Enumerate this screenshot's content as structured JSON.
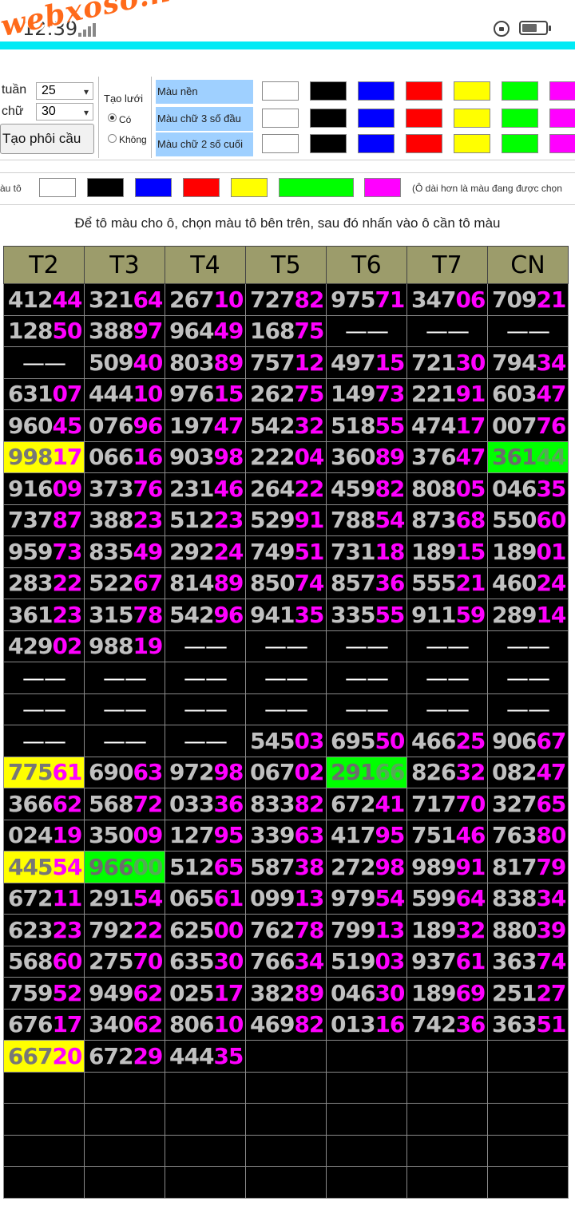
{
  "status_bar": {
    "time": "12:39"
  },
  "watermark": "webxoso.net",
  "controls": {
    "weeks_label": "tuần",
    "weeks_value": "25",
    "digits_label": "chữ",
    "digits_value": "30",
    "create_button": "Tạo phôi cầu",
    "grid_label": "Tạo lưới",
    "grid_yes": "Có",
    "grid_no": "Không"
  },
  "color_rows": [
    {
      "label": "Màu nền"
    },
    {
      "label": "Màu chữ 3 số đầu"
    },
    {
      "label": "Màu chữ 2 số cuối"
    }
  ],
  "palette": [
    "#ffffff",
    "#000000",
    "#0000ff",
    "#ff0000",
    "#ffff00",
    "#00ff00",
    "#ff00ff"
  ],
  "tool": {
    "label": "àu tô",
    "note": "(Ô dài hơn là màu đang được chọn"
  },
  "instruction": "Để tô màu cho ô, chọn màu tô bên trên, sau đó nhấn vào ô cần tô màu",
  "table": {
    "headers": [
      "T2",
      "T3",
      "T4",
      "T5",
      "T6",
      "T7",
      "CN"
    ],
    "rows": [
      [
        {
          "v": "41244"
        },
        {
          "v": "32164"
        },
        {
          "v": "26710"
        },
        {
          "v": "72782"
        },
        {
          "v": "97571"
        },
        {
          "v": "34706"
        },
        {
          "v": "70921"
        }
      ],
      [
        {
          "v": "12850"
        },
        {
          "v": "38897"
        },
        {
          "v": "96449"
        },
        {
          "v": "16875"
        },
        {
          "v": "—"
        },
        {
          "v": "—"
        },
        {
          "v": "—"
        }
      ],
      [
        {
          "v": "—"
        },
        {
          "v": "50940"
        },
        {
          "v": "80389"
        },
        {
          "v": "75712"
        },
        {
          "v": "49715"
        },
        {
          "v": "72130"
        },
        {
          "v": "79434"
        }
      ],
      [
        {
          "v": "63107"
        },
        {
          "v": "44410"
        },
        {
          "v": "97615"
        },
        {
          "v": "26275"
        },
        {
          "v": "14973"
        },
        {
          "v": "22191"
        },
        {
          "v": "60347"
        }
      ],
      [
        {
          "v": "96045"
        },
        {
          "v": "07696"
        },
        {
          "v": "19747"
        },
        {
          "v": "54232"
        },
        {
          "v": "51855"
        },
        {
          "v": "47417"
        },
        {
          "v": "00776"
        }
      ],
      [
        {
          "v": "99817",
          "bg": "yellow"
        },
        {
          "v": "06616"
        },
        {
          "v": "90398"
        },
        {
          "v": "22204"
        },
        {
          "v": "36089"
        },
        {
          "v": "37647"
        },
        {
          "v": "36144",
          "bg": "green"
        }
      ],
      [
        {
          "v": "91609"
        },
        {
          "v": "37376"
        },
        {
          "v": "23146"
        },
        {
          "v": "26422"
        },
        {
          "v": "45982"
        },
        {
          "v": "80805"
        },
        {
          "v": "04635"
        }
      ],
      [
        {
          "v": "73787"
        },
        {
          "v": "38823"
        },
        {
          "v": "51223"
        },
        {
          "v": "52991"
        },
        {
          "v": "78854"
        },
        {
          "v": "87368"
        },
        {
          "v": "55060"
        }
      ],
      [
        {
          "v": "95973"
        },
        {
          "v": "83549"
        },
        {
          "v": "29224"
        },
        {
          "v": "74951"
        },
        {
          "v": "73118"
        },
        {
          "v": "18915"
        },
        {
          "v": "18901"
        }
      ],
      [
        {
          "v": "28322"
        },
        {
          "v": "52267"
        },
        {
          "v": "81489"
        },
        {
          "v": "85074"
        },
        {
          "v": "85736"
        },
        {
          "v": "55521"
        },
        {
          "v": "46024"
        }
      ],
      [
        {
          "v": "36123"
        },
        {
          "v": "31578"
        },
        {
          "v": "54296"
        },
        {
          "v": "94135"
        },
        {
          "v": "33555"
        },
        {
          "v": "91159"
        },
        {
          "v": "28914"
        }
      ],
      [
        {
          "v": "42902"
        },
        {
          "v": "98819"
        },
        {
          "v": "—"
        },
        {
          "v": "—"
        },
        {
          "v": "—"
        },
        {
          "v": "—"
        },
        {
          "v": "—"
        }
      ],
      [
        {
          "v": "—"
        },
        {
          "v": "—"
        },
        {
          "v": "—"
        },
        {
          "v": "—"
        },
        {
          "v": "—"
        },
        {
          "v": "—"
        },
        {
          "v": "—"
        }
      ],
      [
        {
          "v": "—"
        },
        {
          "v": "—"
        },
        {
          "v": "—"
        },
        {
          "v": "—"
        },
        {
          "v": "—"
        },
        {
          "v": "—"
        },
        {
          "v": "—"
        }
      ],
      [
        {
          "v": "—"
        },
        {
          "v": "—"
        },
        {
          "v": "—"
        },
        {
          "v": "54503"
        },
        {
          "v": "69550"
        },
        {
          "v": "46625"
        },
        {
          "v": "90667"
        }
      ],
      [
        {
          "v": "77561",
          "bg": "yellow"
        },
        {
          "v": "69063"
        },
        {
          "v": "97298"
        },
        {
          "v": "06702"
        },
        {
          "v": "29166",
          "bg": "green"
        },
        {
          "v": "82632"
        },
        {
          "v": "08247"
        }
      ],
      [
        {
          "v": "36662"
        },
        {
          "v": "56872"
        },
        {
          "v": "03336"
        },
        {
          "v": "83382"
        },
        {
          "v": "67241"
        },
        {
          "v": "71770"
        },
        {
          "v": "32765"
        }
      ],
      [
        {
          "v": "02419"
        },
        {
          "v": "35009"
        },
        {
          "v": "12795"
        },
        {
          "v": "33963"
        },
        {
          "v": "41795"
        },
        {
          "v": "75146"
        },
        {
          "v": "76380"
        }
      ],
      [
        {
          "v": "44554",
          "bg": "yellow"
        },
        {
          "v": "96600",
          "bg": "green"
        },
        {
          "v": "51265"
        },
        {
          "v": "58738"
        },
        {
          "v": "27298"
        },
        {
          "v": "98991"
        },
        {
          "v": "81779"
        }
      ],
      [
        {
          "v": "67211"
        },
        {
          "v": "29154"
        },
        {
          "v": "06561"
        },
        {
          "v": "09913"
        },
        {
          "v": "97954"
        },
        {
          "v": "59964"
        },
        {
          "v": "83834"
        }
      ],
      [
        {
          "v": "62323"
        },
        {
          "v": "79222"
        },
        {
          "v": "62500"
        },
        {
          "v": "76278"
        },
        {
          "v": "79913"
        },
        {
          "v": "18932"
        },
        {
          "v": "88039"
        }
      ],
      [
        {
          "v": "56860"
        },
        {
          "v": "27570"
        },
        {
          "v": "63530"
        },
        {
          "v": "76634"
        },
        {
          "v": "51903"
        },
        {
          "v": "93761"
        },
        {
          "v": "36374"
        }
      ],
      [
        {
          "v": "75952"
        },
        {
          "v": "94962"
        },
        {
          "v": "02517"
        },
        {
          "v": "38289"
        },
        {
          "v": "04630"
        },
        {
          "v": "18969"
        },
        {
          "v": "25127"
        }
      ],
      [
        {
          "v": "67617"
        },
        {
          "v": "34062"
        },
        {
          "v": "80610"
        },
        {
          "v": "46982"
        },
        {
          "v": "01316"
        },
        {
          "v": "74236"
        },
        {
          "v": "36351"
        }
      ],
      [
        {
          "v": "66720",
          "bg": "yellow"
        },
        {
          "v": "67229"
        },
        {
          "v": "44435"
        },
        {
          "v": ""
        },
        {
          "v": ""
        },
        {
          "v": ""
        },
        {
          "v": ""
        }
      ],
      [
        {
          "v": ""
        },
        {
          "v": ""
        },
        {
          "v": ""
        },
        {
          "v": ""
        },
        {
          "v": ""
        },
        {
          "v": ""
        },
        {
          "v": ""
        }
      ],
      [
        {
          "v": ""
        },
        {
          "v": ""
        },
        {
          "v": ""
        },
        {
          "v": ""
        },
        {
          "v": ""
        },
        {
          "v": ""
        },
        {
          "v": ""
        }
      ],
      [
        {
          "v": ""
        },
        {
          "v": ""
        },
        {
          "v": ""
        },
        {
          "v": ""
        },
        {
          "v": ""
        },
        {
          "v": ""
        },
        {
          "v": ""
        }
      ],
      [
        {
          "v": ""
        },
        {
          "v": ""
        },
        {
          "v": ""
        },
        {
          "v": ""
        },
        {
          "v": ""
        },
        {
          "v": ""
        },
        {
          "v": ""
        }
      ]
    ]
  }
}
